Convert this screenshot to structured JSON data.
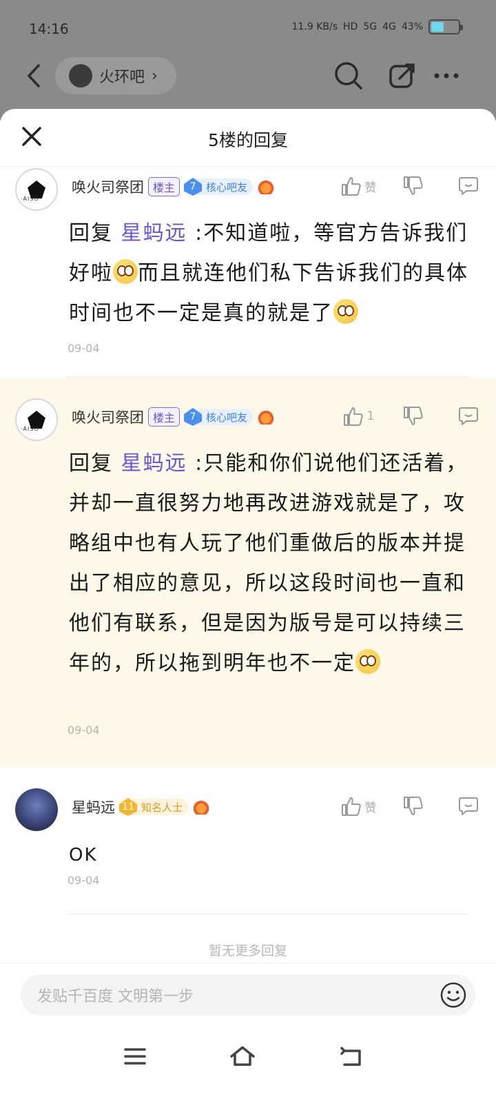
{
  "status_bar": {
    "time": "14:16",
    "speed": "11.9 KB/s",
    "hd": "HD",
    "net1": "5G",
    "net2": "4G",
    "battery": "43%"
  },
  "nav": {
    "forum_name": "火环吧"
  },
  "sheet": {
    "title": "5楼的回复"
  },
  "replies": [
    {
      "username": "唤火司祭团",
      "owner_badge": "楼主",
      "level": "7",
      "level_title": "核心吧友",
      "like_label": "赞",
      "mention": "星蚂远",
      "text_before": "回复 ",
      "text_a": " :不知道啦，等官方告诉我们好啦",
      "text_b": "而且就连他们私下告诉我们的具体时间也不一定是真的就是了",
      "date": "09-04"
    },
    {
      "username": "唤火司祭团",
      "owner_badge": "楼主",
      "level": "7",
      "level_title": "核心吧友",
      "like_label": "1",
      "mention": "星蚂远",
      "text_before": "回复 ",
      "text_a": " :只能和你们说他们还活着，并却一直很努力地再改进游戏就是了，攻略组中也有人玩了他们重做后的版本并提出了相应的意见，所以这段时间也一直和他们有联系，但是因为版号是可以持续三年的，所以拖到明年也不一定",
      "date": "09-04"
    },
    {
      "username": "星蚂远",
      "level": "11",
      "level_title": "知名人士",
      "like_label": "赞",
      "text": "OK",
      "date": "09-04"
    }
  ],
  "no_more": "暂无更多回复",
  "input": {
    "placeholder": "发贴千百度 文明第一步"
  },
  "colors": {
    "accent": "#6a55d8",
    "highlight_bg": "#fdf8e8",
    "level_blue": "#4a8ef0",
    "level_gold": "#f5b52a"
  }
}
